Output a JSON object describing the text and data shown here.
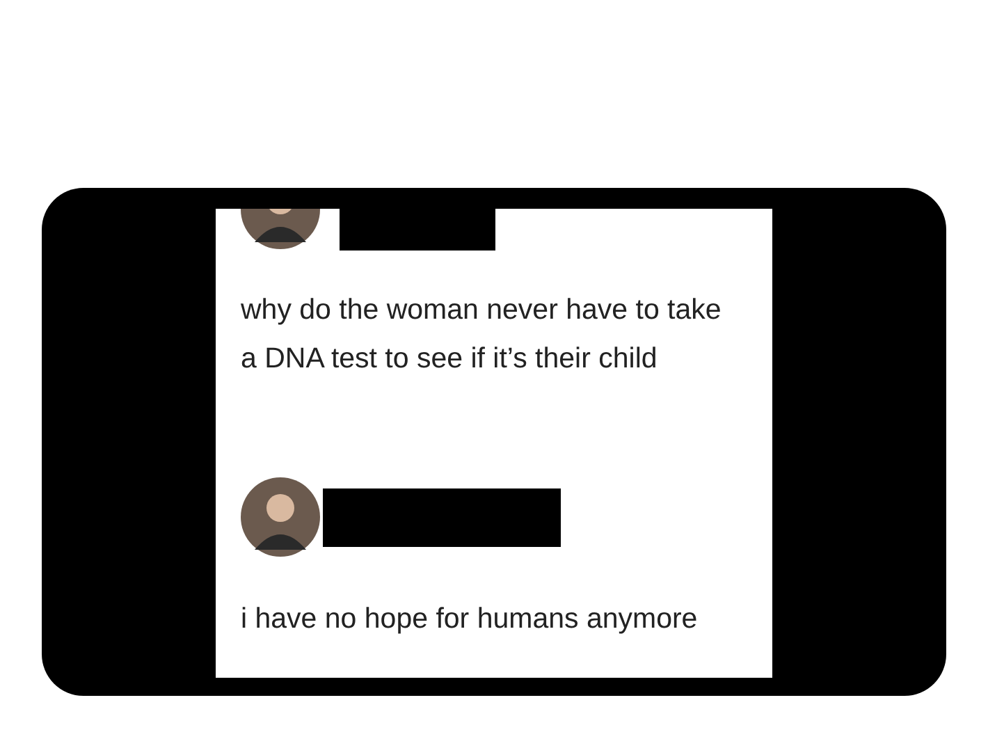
{
  "tweets": [
    {
      "lines": [
        "why do the woman never have to take",
        "a DNA test to see if it’s their child"
      ]
    },
    {
      "lines": [
        "i have no hope for humans anymore"
      ]
    }
  ]
}
